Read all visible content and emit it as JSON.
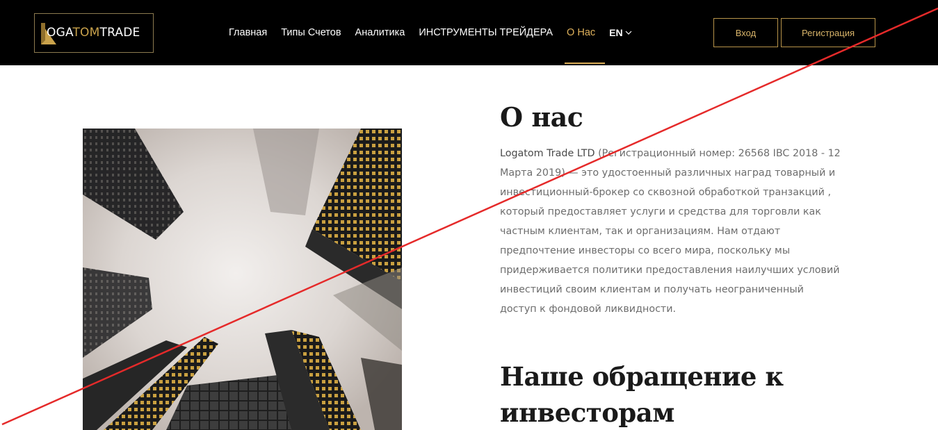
{
  "header": {
    "logo": {
      "prefix": "OGA",
      "middle": "TOM",
      "suffix": "TRADE"
    },
    "nav": [
      {
        "label": "Главная"
      },
      {
        "label": "Типы Счетов"
      },
      {
        "label": "Аналитика"
      },
      {
        "label": "ИНСТРУМЕНТЫ ТРЕЙДЕРА"
      },
      {
        "label": "О Нас",
        "active": true
      }
    ],
    "language": "EN",
    "login_label": "Вход",
    "register_label": "Регистрация"
  },
  "about": {
    "title": "О нас",
    "company": "Logatom Trade LTD",
    "description": " (Регистрационный номер: 26568 IBC 2018 - 12 Марта 2019) — это удостоенный различных наград товарный и инвестиционный-брокер со сквозной обработкой транзакций , который предоставляет услуги и средства для торговли как частным клиентам, так и организациям. Нам отдают предпочтение инвесторы со всего мира, поскольку мы придерживается политики предоставления наилучших условий инвестиций своим клиентам и получать неограниченный доступ к фондовой ликвидности."
  },
  "appeal": {
    "title": "Наше обращение к инвесторам"
  },
  "colors": {
    "header_bg": "#000000",
    "accent_gold": "#d9ac55",
    "strike_red": "#e52a2a"
  }
}
